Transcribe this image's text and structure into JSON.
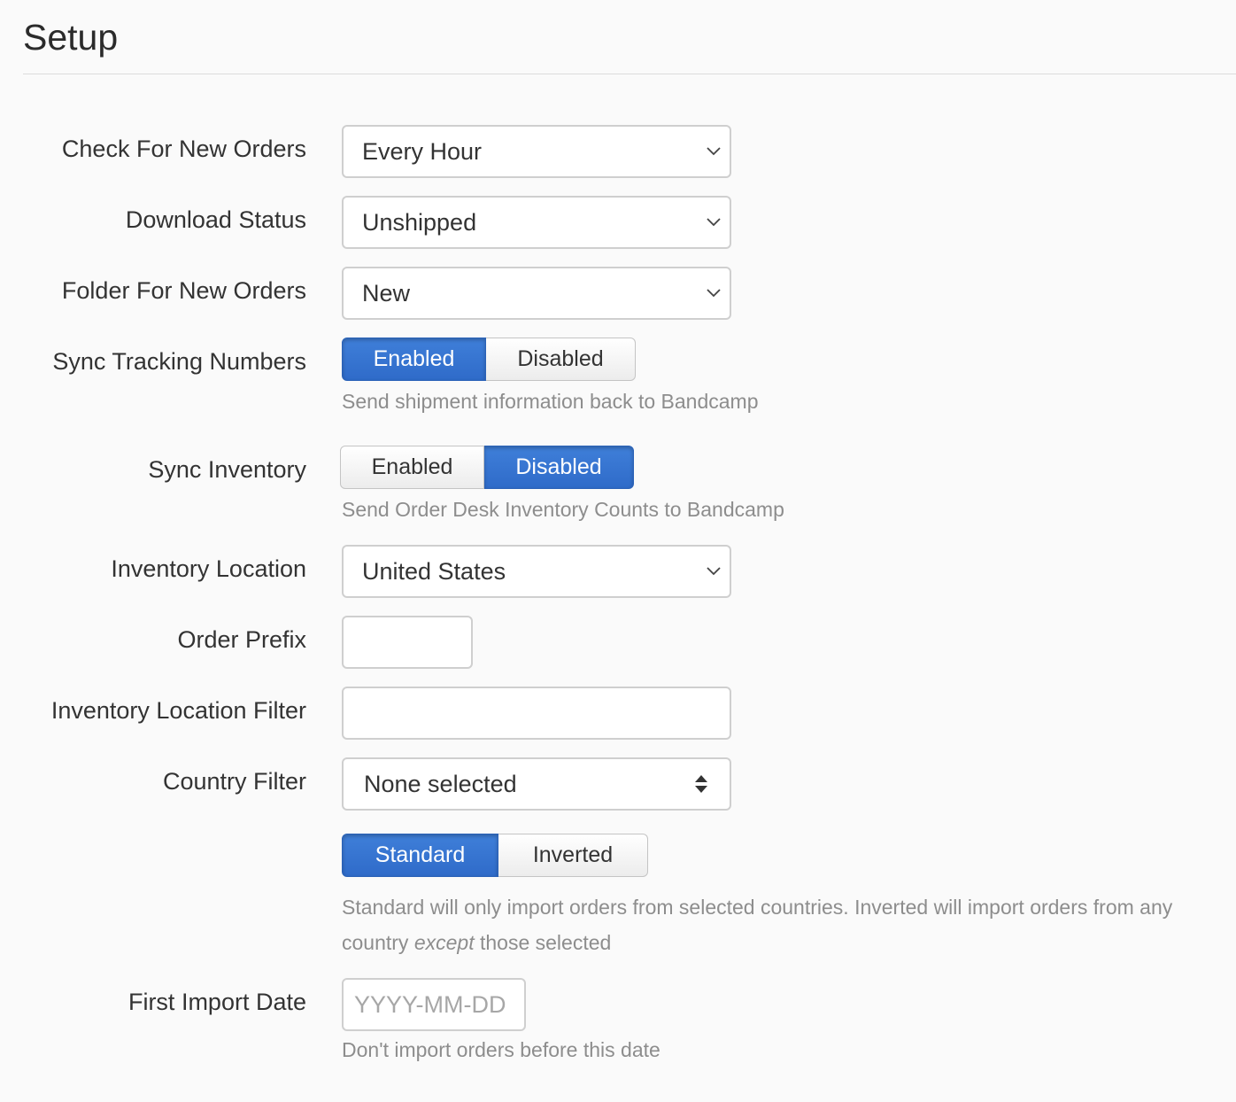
{
  "page": {
    "title": "Setup"
  },
  "fields": {
    "check_new_orders": {
      "label": "Check For New Orders",
      "value": "Every Hour"
    },
    "download_status": {
      "label": "Download Status",
      "value": "Unshipped"
    },
    "folder_new_orders": {
      "label": "Folder For New Orders",
      "value": "New"
    },
    "sync_tracking": {
      "label": "Sync Tracking Numbers",
      "enabled_label": "Enabled",
      "disabled_label": "Disabled",
      "selected": "Enabled",
      "help": "Send shipment information back to Bandcamp"
    },
    "sync_inventory": {
      "label": "Sync Inventory",
      "enabled_label": "Enabled",
      "disabled_label": "Disabled",
      "selected": "Disabled",
      "help": "Send Order Desk Inventory Counts to Bandcamp"
    },
    "inventory_location": {
      "label": "Inventory Location",
      "value": "United States"
    },
    "order_prefix": {
      "label": "Order Prefix",
      "value": ""
    },
    "inventory_location_filter": {
      "label": "Inventory Location Filter",
      "value": ""
    },
    "country_filter": {
      "label": "Country Filter",
      "value": "None selected",
      "standard_label": "Standard",
      "inverted_label": "Inverted",
      "selected_mode": "Standard",
      "help_part1": "Standard will only import orders from selected countries. Inverted will import orders from any country ",
      "help_em": "except",
      "help_part2": " those selected"
    },
    "first_import_date": {
      "label": "First Import Date",
      "value": "",
      "placeholder": "YYYY-MM-DD",
      "help": "Don't import orders before this date"
    }
  },
  "colors": {
    "accent": "#2f6bc9",
    "help_text": "#8d8d8d",
    "background": "#fafafa"
  },
  "icons": {
    "select_caret": "chevron-down-icon",
    "multiselect_caret": "sort-updown-icon"
  }
}
